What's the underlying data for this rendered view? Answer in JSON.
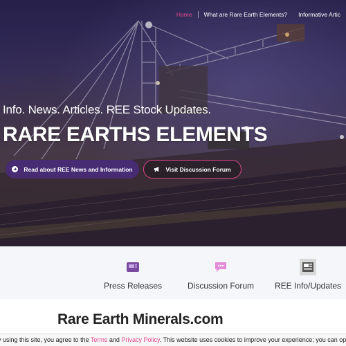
{
  "nav": {
    "items": [
      {
        "label": "Home",
        "active": true
      },
      {
        "label": "What are Rare Earth Elements?",
        "active": false
      },
      {
        "label": "Informative Artic",
        "active": false
      }
    ]
  },
  "hero": {
    "tagline": "Info. News. Articles. REE Stock Updates.",
    "title": "RARE EARTHS ELEMENTS",
    "primary_button": "Read about REE News and Information",
    "secondary_button": "Visit Discussion Forum"
  },
  "features": [
    {
      "label": "Press Releases",
      "icon": "press-releases-icon",
      "color": "#7a4aa0"
    },
    {
      "label": "Discussion Forum",
      "icon": "chat-bubble-icon",
      "color": "#e48bd8"
    },
    {
      "label": "REE Info/Updates",
      "icon": "newspaper-icon",
      "color": "#555555"
    }
  ],
  "site_name": "Rare Earth Minerals.com",
  "cookie": {
    "prefix": "y using this site, you agree to the ",
    "terms_link": "Terms",
    "middle": " and ",
    "privacy_link": "Privacy Policy",
    "suffix": ". This website uses cookies to improve your experience; you can opt-out:"
  },
  "colors": {
    "accent": "#e0478a",
    "primary_button": "#472c74"
  }
}
